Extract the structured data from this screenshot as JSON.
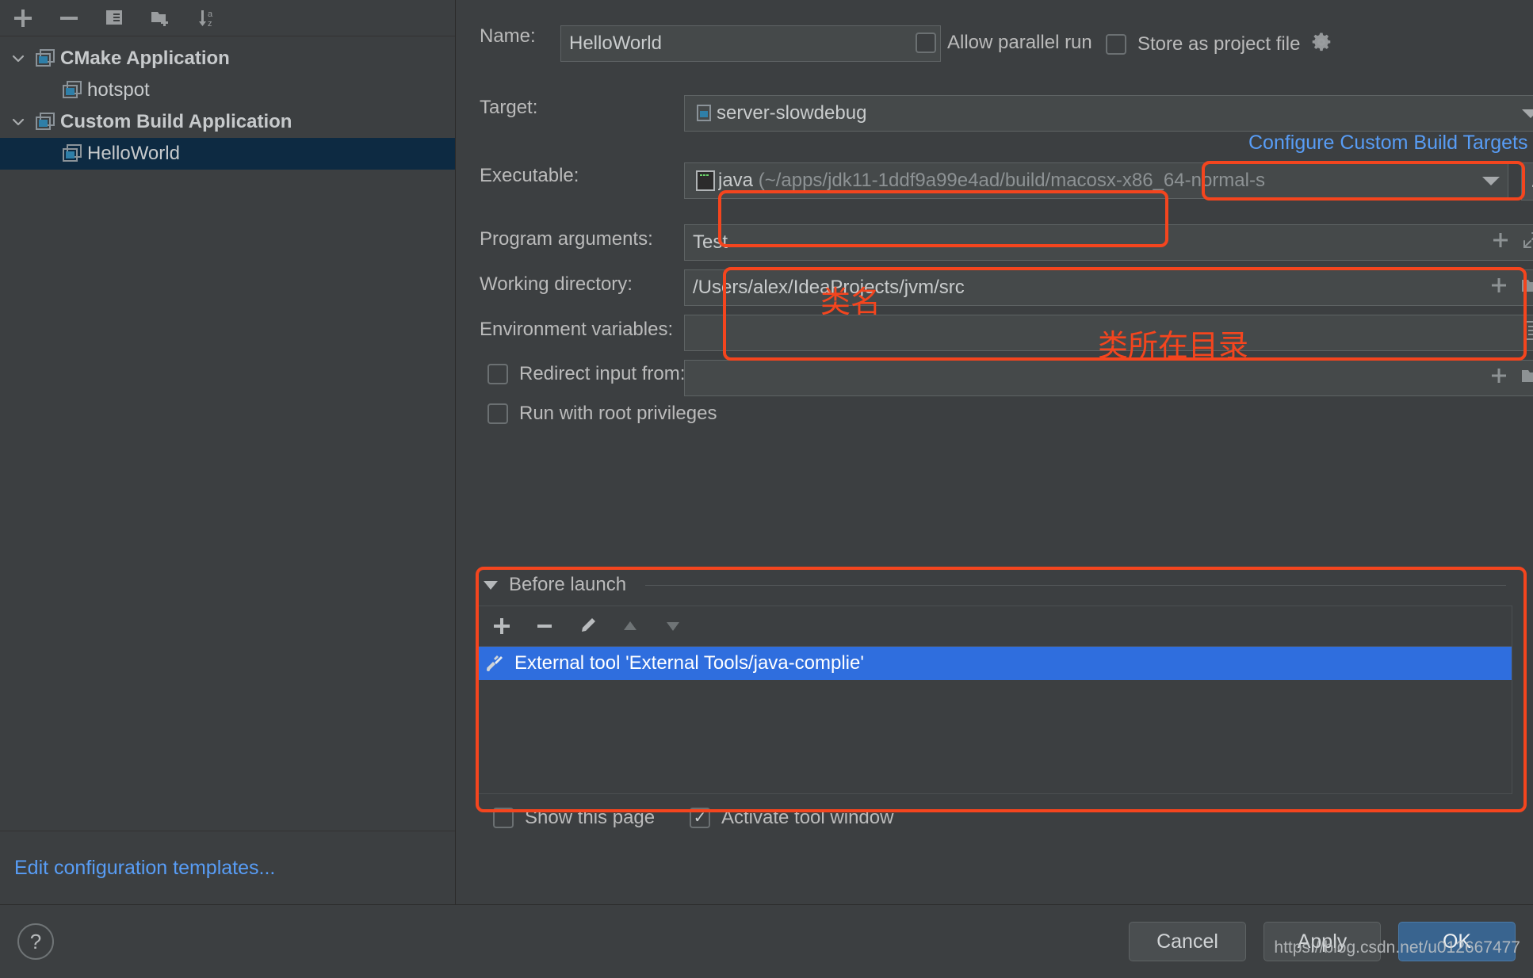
{
  "sidebar": {
    "toolbar": [
      {
        "name": "add-configuration-button",
        "icon": "plus-icon"
      },
      {
        "name": "remove-configuration-button",
        "icon": "minus-icon"
      },
      {
        "name": "copy-configuration-button",
        "icon": "copy-icon"
      },
      {
        "name": "new-folder-button",
        "icon": "new-folder-icon"
      },
      {
        "name": "sort-alphabetically-button",
        "icon": "sort-az-icon"
      }
    ],
    "tree": [
      {
        "label": "CMake Application",
        "level": 0,
        "group": true,
        "expanded": true,
        "selected": false
      },
      {
        "label": "hotspot",
        "level": 1,
        "group": false,
        "expanded": false,
        "selected": false
      },
      {
        "label": "Custom Build Application",
        "level": 0,
        "group": true,
        "expanded": true,
        "selected": false
      },
      {
        "label": "HelloWorld",
        "level": 1,
        "group": false,
        "expanded": false,
        "selected": true
      }
    ],
    "edit_templates_link": "Edit configuration templates..."
  },
  "form": {
    "name_label": "Name:",
    "name_value": "HelloWorld",
    "allow_parallel_run_label": "Allow parallel run",
    "allow_parallel_run_checked": false,
    "store_as_project_file_label": "Store as project file",
    "store_as_project_file_checked": false,
    "target_label": "Target:",
    "target_value": "server-slowdebug",
    "configure_targets_link": "Configure Custom Build Targets",
    "executable_label": "Executable:",
    "executable_value": "java",
    "executable_path": "(~/apps/jdk11-1ddf9a99e4ad/build/macosx-x86_64-normal-s",
    "browse_button_label": "...",
    "program_arguments_label": "Program arguments:",
    "program_arguments_value": "Test",
    "working_directory_label": "Working directory:",
    "working_directory_value": "/Users/alex/IdeaProjects/jvm/src",
    "environment_variables_label": "Environment variables:",
    "environment_variables_value": "",
    "redirect_input_label": "Redirect input from:",
    "redirect_input_checked": false,
    "redirect_input_value": "",
    "run_with_root_label": "Run with root privileges",
    "run_with_root_checked": false
  },
  "before_launch": {
    "title": "Before launch",
    "toolbar": [
      {
        "name": "add-task-button",
        "icon": "plus-icon",
        "disabled": false
      },
      {
        "name": "remove-task-button",
        "icon": "minus-icon",
        "disabled": false
      },
      {
        "name": "edit-task-button",
        "icon": "pencil-icon",
        "disabled": false
      },
      {
        "name": "move-task-up-button",
        "icon": "arrow-up-icon",
        "disabled": true
      },
      {
        "name": "move-task-down-button",
        "icon": "arrow-down-icon",
        "disabled": true
      }
    ],
    "items": [
      {
        "label": "External tool 'External Tools/java-complie'",
        "selected": true
      }
    ],
    "show_this_page_label": "Show this page",
    "show_this_page_checked": false,
    "activate_tool_window_label": "Activate tool window",
    "activate_tool_window_checked": true
  },
  "footer": {
    "help_label": "?",
    "cancel_label": "Cancel",
    "apply_label": "Apply",
    "ok_label": "OK"
  },
  "annotations": {
    "class_name_note": "类名",
    "class_directory_note": "类所在目录"
  },
  "watermark": "https://blog.csdn.net/u012667477",
  "colors": {
    "background": "#3c3f41",
    "selection_tree": "#0d2a42",
    "selection_list": "#2f6ede",
    "link": "#589df6",
    "annotation_red": "#f4451e",
    "primary_button": "#39648f"
  }
}
